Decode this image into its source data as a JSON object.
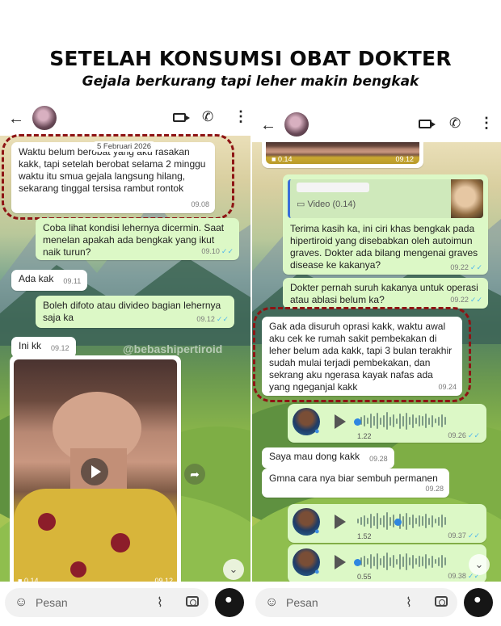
{
  "header": {
    "title": "SETELAH KONSUMSI OBAT DOKTER",
    "subtitle": "Gejala berkurang tapi leher makin bengkak"
  },
  "left": {
    "date_chip": "5 Februari 2026",
    "watermark": "@bebashipertiroid",
    "messages": [
      {
        "dir": "in",
        "text": "Waktu belum berobat yang aku rasakan kakk, tapi setelah berobat selama 2 minggu waktu itu smua gejala langsung hilang, sekarang tinggal tersisa rambut rontok",
        "time": "09.08"
      },
      {
        "dir": "out",
        "text": "Coba lihat kondisi lehernya dicermin. Saat menelan apakah ada bengkak yang ikut naik turun?",
        "time": "09.10"
      },
      {
        "dir": "in",
        "text": "Ada kak",
        "time": "09.11"
      },
      {
        "dir": "out",
        "text": "Boleh difoto atau divideo bagian lehernya saja ka",
        "time": "09.12"
      },
      {
        "dir": "in",
        "text": "Ini kk",
        "time": "09.12"
      }
    ],
    "video": {
      "duration": "0.14",
      "time": "09.12"
    },
    "input_placeholder": "Pesan"
  },
  "right": {
    "top_video": {
      "duration": "0.14",
      "time": "09.12"
    },
    "quote_label": "Video (0.14)",
    "messages": [
      {
        "dir": "out",
        "text": "Terima kasih ka, ini ciri khas bengkak pada hipertiroid yang disebabkan oleh autoimun graves. Dokter ada bilang mengenai graves disease ke kakanya?",
        "time": "09.22"
      },
      {
        "dir": "out",
        "text": "Dokter pernah suruh kakanya untuk operasi atau ablasi belum ka?",
        "time": "09.22"
      },
      {
        "dir": "in",
        "text": "Gak ada disuruh oprasi kakk, waktu awal aku cek ke rumah sakit pembekakan di leher belum ada kakk, tapi 3 bulan terakhir sudah mulai terjadi pembekakan, dan sekrang aku ngerasa kayak nafas ada yang ngeganjal kakk",
        "time": "09.24"
      },
      {
        "dir": "in",
        "text": "Saya mau dong kakk",
        "time": "09.28"
      },
      {
        "dir": "in",
        "text": "Gmna cara nya biar sembuh permanen",
        "time": "09.28"
      }
    ],
    "voice_notes": [
      {
        "duration": "1.22",
        "time": "09.26",
        "progress": 0.0
      },
      {
        "duration": "1.52",
        "time": "09.37",
        "progress": 0.45
      },
      {
        "duration": "0.55",
        "time": "09.38",
        "progress": 0.0
      }
    ],
    "input_placeholder": "Pesan"
  },
  "icons": {
    "back": "arrow-left-icon",
    "video_call": "video-camera-icon",
    "call": "phone-icon",
    "more": "kebab-menu-icon",
    "emoji": "sticker-icon",
    "attach": "paperclip-icon",
    "camera": "camera-icon",
    "mic": "microphone-icon"
  },
  "colors": {
    "outgoing_bubble": "#dcf8c6",
    "incoming_bubble": "#ffffff",
    "highlight_ring": "#8e1414",
    "read_tick": "#4fb6ec"
  }
}
